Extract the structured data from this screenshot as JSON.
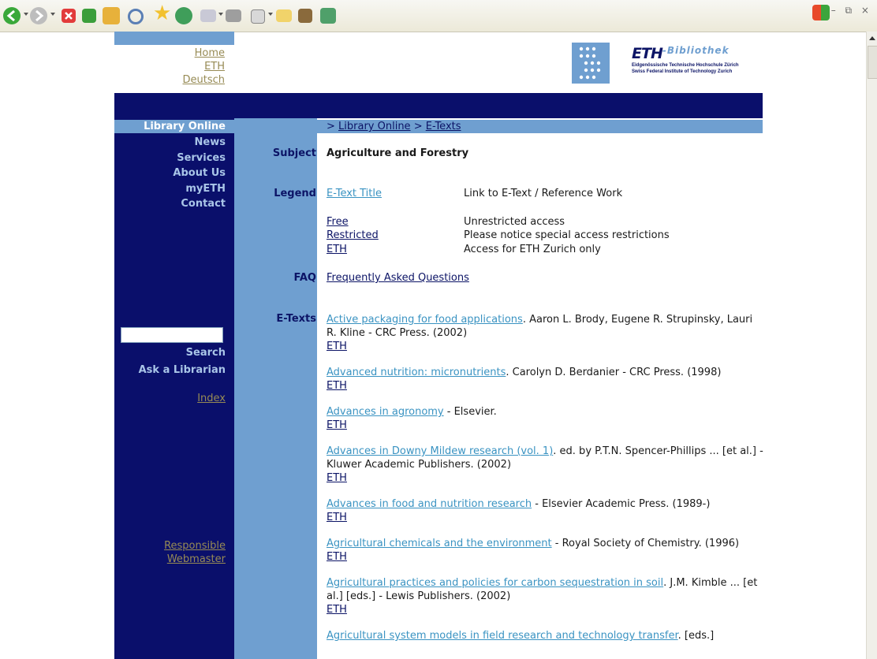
{
  "header": {
    "top_links": [
      "Home",
      "ETH",
      "Deutsch"
    ],
    "logo": {
      "eth": "ETH",
      "bibliothek": "-Bibliothek",
      "line1": "Eidgenössische Technische Hochschule Zürich",
      "line2": "Swiss Federal Institute of Technology Zurich"
    }
  },
  "sidebar": {
    "head": "Library Online",
    "nav": [
      "News",
      "Services",
      "About Us",
      "myETH",
      "Contact"
    ],
    "search_value": "",
    "search_label": "Search",
    "ask": "Ask a Librarian",
    "index": "Index",
    "responsible": "Responsible",
    "webmaster": "Webmaster"
  },
  "breadcrumb": {
    "prefix1": "> ",
    "item1": "Library Online",
    "prefix2": " > ",
    "item2": "E-Texts"
  },
  "labels": {
    "subject": "Subject",
    "legend": "Legend",
    "faq": "FAQ",
    "etexts": "E-Texts"
  },
  "subject_value": "Agriculture and Forestry",
  "legend": [
    {
      "term": "E-Text Title",
      "desc": "Link to E-Text / Reference Work"
    },
    {
      "term": "Free",
      "desc": "Unrestricted access"
    },
    {
      "term": "Restricted",
      "desc": "Please notice special access restrictions"
    },
    {
      "term": "ETH",
      "desc": "Access for ETH Zurich only"
    }
  ],
  "faq_link": "Frequently Asked Questions",
  "etexts": [
    {
      "title": "Active packaging for food applications",
      "rest": ". Aaron L. Brody, Eugene R. Strupinsky, Lauri R. Kline - CRC Press. (2002)",
      "access": "ETH"
    },
    {
      "title": "Advanced nutrition: micronutrients",
      "rest": ". Carolyn D. Berdanier - CRC Press. (1998)",
      "access": "ETH"
    },
    {
      "title": "Advances in agronomy",
      "rest": " - Elsevier.",
      "access": "ETH"
    },
    {
      "title": "Advances in Downy Mildew research (vol. 1)",
      "rest": ". ed. by P.T.N. Spencer-Phillips ... [et al.] - Kluwer Academic Publishers. (2002)",
      "access": "ETH"
    },
    {
      "title": "Advances in food and nutrition research",
      "rest": " - Elsevier Academic Press. (1989-)",
      "access": "ETH"
    },
    {
      "title": "Agricultural chemicals and the environment",
      "rest": " - Royal Society of Chemistry. (1996)",
      "access": "ETH"
    },
    {
      "title": "Agricultural practices and policies for carbon sequestration in soil",
      "rest": ". J.M. Kimble ... [et al.] [eds.] - Lewis Publishers. (2002)",
      "access": "ETH"
    },
    {
      "title": "Agricultural system models in field research and technology transfer",
      "rest": ". [eds.]",
      "access": ""
    }
  ],
  "colors": {
    "navy": "#0a0f6b",
    "light_blue": "#6f9fd0",
    "teal_link": "#3a93c2",
    "olive_link": "#978b55"
  }
}
